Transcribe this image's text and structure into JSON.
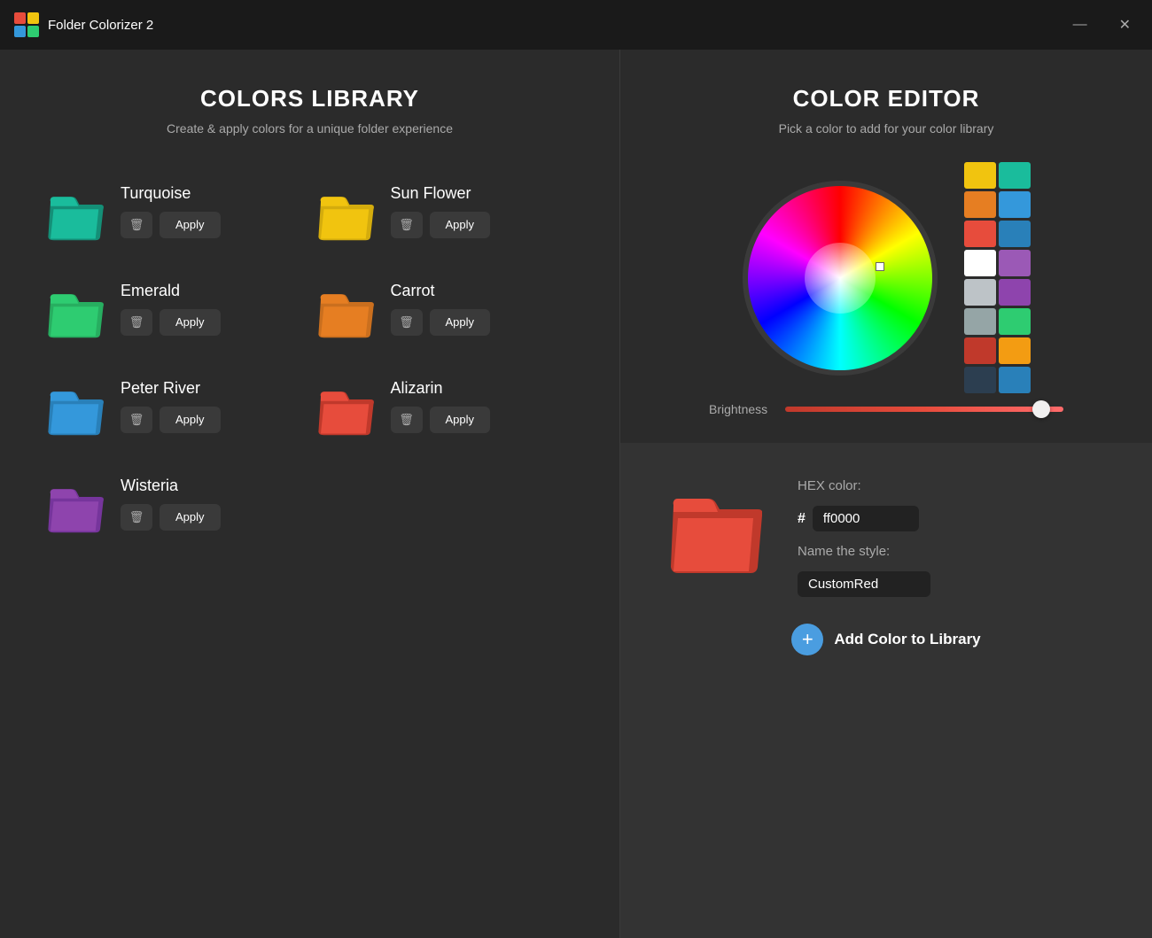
{
  "app": {
    "title": "Folder Colorizer 2",
    "minimize_label": "—",
    "close_label": "✕"
  },
  "left": {
    "title": "COLORS LIBRARY",
    "subtitle": "Create & apply colors for a unique folder experience",
    "colors": [
      {
        "id": "turquoise",
        "name": "Turquoise",
        "color": "#1abc9c",
        "dark": "#148f77"
      },
      {
        "id": "sunflower",
        "name": "Sun Flower",
        "color": "#f1c40f",
        "dark": "#d4ac0d"
      },
      {
        "id": "emerald",
        "name": "Emerald",
        "color": "#2ecc71",
        "dark": "#27ae60"
      },
      {
        "id": "carrot",
        "name": "Carrot",
        "color": "#e67e22",
        "dark": "#ca6f1e"
      },
      {
        "id": "peterriver",
        "name": "Peter River",
        "color": "#3498db",
        "dark": "#2980b9"
      },
      {
        "id": "alizarin",
        "name": "Alizarin",
        "color": "#e74c3c",
        "dark": "#c0392b"
      },
      {
        "id": "wisteria",
        "name": "Wisteria",
        "color": "#8e44ad",
        "dark": "#76359c"
      }
    ],
    "delete_label": "🗑",
    "apply_label": "Apply"
  },
  "right": {
    "title": "COLOR EDITOR",
    "subtitle": "Pick a color to add for your color library",
    "brightness_label": "Brightness",
    "hex_label": "HEX color:",
    "hex_value": "ff0000",
    "name_label": "Name the style:",
    "name_value": "CustomRed",
    "add_label": "Add Color to Library",
    "swatches": [
      "#f1c40f",
      "#1abc9c",
      "#e67e22",
      "#3498db",
      "#e74c3c",
      "#2980b9",
      "#ffffff",
      "#9b59b6",
      "#bdc3c7",
      "#8e44ad",
      "#95a5a6",
      "#2ecc71",
      "#c0392b",
      "#f39c12",
      "#2c3e50",
      "#2980b9"
    ]
  }
}
